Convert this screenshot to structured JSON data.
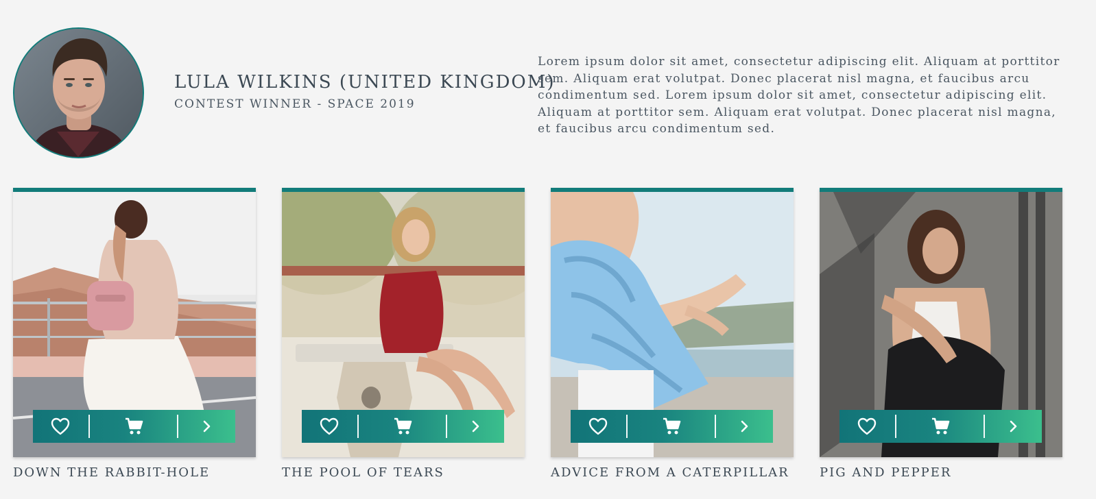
{
  "profile": {
    "name": "LULA WILKINS (UNITED KINGDOM)",
    "subtitle": "CONTEST WINNER - SPACE 2019",
    "bio": "Lorem ipsum dolor sit amet, consectetur adipiscing elit. Aliquam at porttitor\nsem.  Aliquam erat volutpat. Donec placerat nisl magna, et faucibus arcu\ncondimentum sed. Lorem ipsum dolor sit amet, consectetur adipiscing elit.\nAliquam at porttitor sem.  Aliquam erat volutpat. Donec placerat nisl magna,\net faucibus arcu condimentum sed.",
    "avatar_icon": "portrait-photo"
  },
  "theme": {
    "accent": "#127c7a",
    "gradient_start": "#127478",
    "gradient_end": "#3bbf8d",
    "text": "#3b4853",
    "background": "#f4f4f4"
  },
  "cards": [
    {
      "title": "DOWN THE RABBIT-HOLE",
      "image": "woman-with-pink-backpack-photo",
      "actions": [
        "heart-icon",
        "cart-icon",
        "chevron-right-icon"
      ]
    },
    {
      "title": "THE POOL OF TEARS",
      "image": "woman-in-red-dress-sitting-photo",
      "actions": [
        "heart-icon",
        "cart-icon",
        "chevron-right-icon"
      ]
    },
    {
      "title": "ADVICE FROM A CATERPILLAR",
      "image": "woman-blue-knit-sweater-photo",
      "actions": [
        "heart-icon",
        "cart-icon",
        "chevron-right-icon"
      ]
    },
    {
      "title": "PIG AND PEPPER",
      "image": "woman-in-shadow-photo",
      "actions": [
        "heart-icon",
        "cart-icon",
        "chevron-right-icon"
      ]
    }
  ]
}
